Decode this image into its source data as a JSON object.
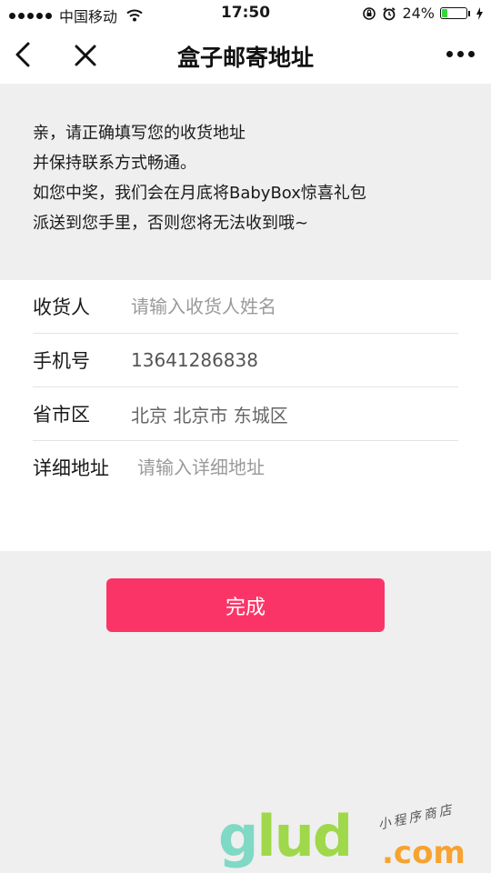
{
  "status_bar": {
    "carrier": "中国移动",
    "time": "17:50",
    "battery_text": "24%",
    "battery_level": 0.24
  },
  "nav": {
    "title": "盒子邮寄地址"
  },
  "notice": {
    "lines": [
      "亲，请正确填写您的收货地址",
      "并保持联系方式畅通。",
      "如您中奖，我们会在月底将BabyBox惊喜礼包",
      "派送到您手里，否则您将无法收到哦~"
    ]
  },
  "form": {
    "recipient_label": "收货人",
    "recipient_placeholder": "请输入收货人姓名",
    "phone_label": "手机号",
    "phone_value": "13641286838",
    "region_label": "省市区",
    "region_value": "北京 北京市 东城区",
    "address_label": "详细地址",
    "address_placeholder": "请输入详细地址"
  },
  "submit_label": "完成",
  "watermark": {
    "text_g": "g",
    "text_lud": "lud",
    "text_com": ".com",
    "tagline": "小程序商店"
  }
}
